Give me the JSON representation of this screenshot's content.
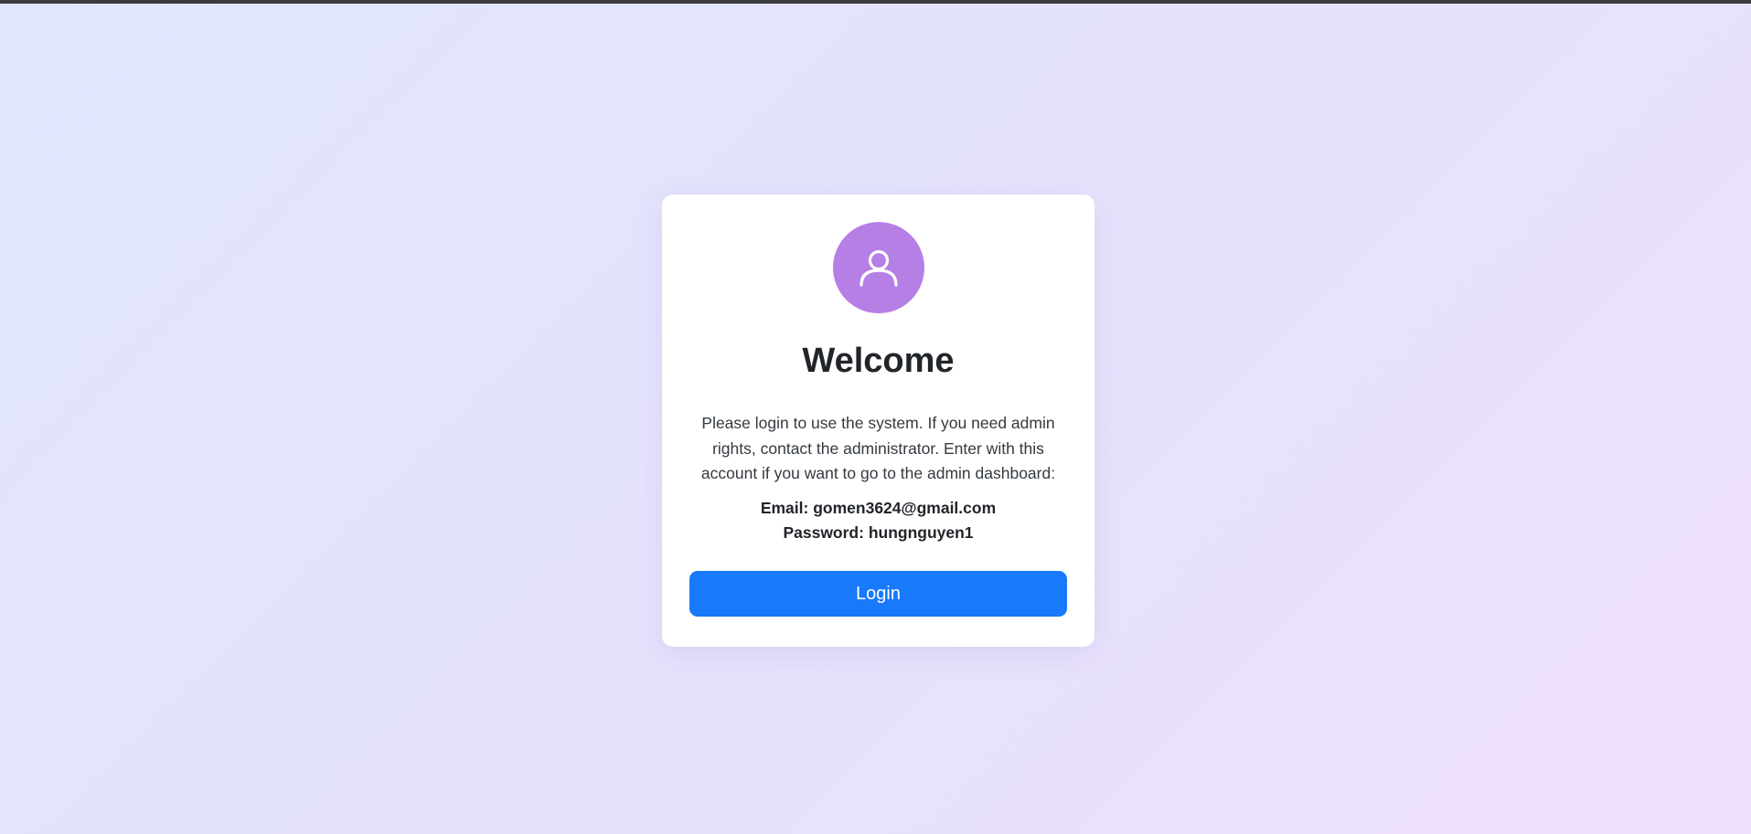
{
  "login": {
    "avatar_icon": "user-icon",
    "title": "Welcome",
    "description": "Please login to use the system. If you need admin rights, contact the administrator. Enter with this account if you want to go to the admin dashboard:",
    "email_label": "Email:",
    "email_value": "gomen3624@gmail.com",
    "password_label": "Password:",
    "password_value": "hungnguyen1",
    "login_button_label": "Login"
  },
  "colors": {
    "background_start": "#e1e6ff",
    "background_end": "#eee0fb",
    "top_strip": "#3b3b3e",
    "card": "#ffffff",
    "avatar": "#b57fe6",
    "primary_button": "#1879fb",
    "text": "#212529"
  }
}
